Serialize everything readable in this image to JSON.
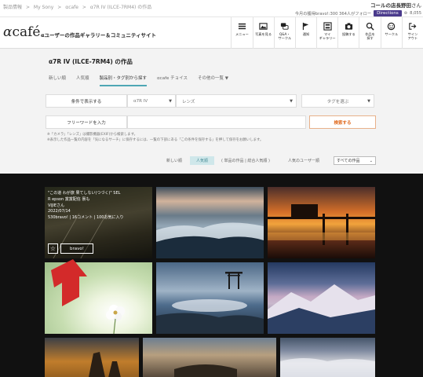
{
  "breadcrumb": [
    "製品情報",
    ">",
    "My Sony",
    ">",
    "αcafe",
    ">",
    "α7R IV (ILCE-7RM4) の作品"
  ],
  "user": {
    "name": "コールの店長野田",
    "suffix": "さん",
    "status_text": "今月の獲得bravo!:300  364人がフォロー",
    "badge": "Directions",
    "points": "8,055"
  },
  "logo": {
    "alpha": "α",
    "text": "café"
  },
  "tagline": "αユーザーの作品ギャラリー＆コミュニティサイト",
  "nav": [
    {
      "icon": "menu-icon",
      "label": "メニュー"
    },
    {
      "icon": "image-icon",
      "label": "写真を見る"
    },
    {
      "icon": "chat-icon",
      "label": "Q&A・\nサークル"
    },
    {
      "icon": "flag-icon",
      "label": "通知"
    },
    {
      "icon": "gallery-icon",
      "label": "マイ\nギャラリー"
    },
    {
      "icon": "camera-icon",
      "label": "投稿する"
    },
    {
      "icon": "search-icon",
      "label": "作品を\n探す"
    },
    {
      "icon": "circle-icon",
      "label": "サークル"
    },
    {
      "icon": "signout-icon",
      "label": "サイン\nアウト"
    }
  ],
  "page_title": "α7R IV (ILCE-7RM4) の作品",
  "tabs": [
    {
      "label": "新しい順"
    },
    {
      "label": "人気順"
    },
    {
      "label": "製品別・タグ別から探す"
    },
    {
      "label": "αcafe チョイス"
    },
    {
      "label": "その他の一覧 ▼"
    }
  ],
  "filter": {
    "condition_label": "条件で表示する",
    "model_value": "α7R IV",
    "lens_placeholder": "レンズ",
    "tag_placeholder": "タグを選ぶ",
    "freeword_label": "フリーワードを入力",
    "search_button": "検索する",
    "note1": "※「カメラ」「レンズ」は撮影機器(EXIF)から検索します。",
    "note2": "※表示した作品一覧の内容を「気になるサーチ」に保存するには、一覧の下部にある「この条件を保存する」を押して保存をお願いします。"
  },
  "sort": {
    "new": "新しい順",
    "popular": "人気順",
    "popular_sub": "( 単品の作品 | 総合人気順 )",
    "users": "人気のユーザー順",
    "all_works": "すべての作品"
  },
  "gallery": {
    "featured": {
      "title_line1": "\"この道  わが旅  果てしない(つづく)\"  SEL",
      "title_line2": "R epson  賞賞配信  褒も",
      "author": "VIJIEさん",
      "date": "2022/07/14",
      "stats": "530bravo! | 16コメント | 100お気に入り",
      "star": "☆",
      "bravo_label": "bravo!"
    }
  }
}
